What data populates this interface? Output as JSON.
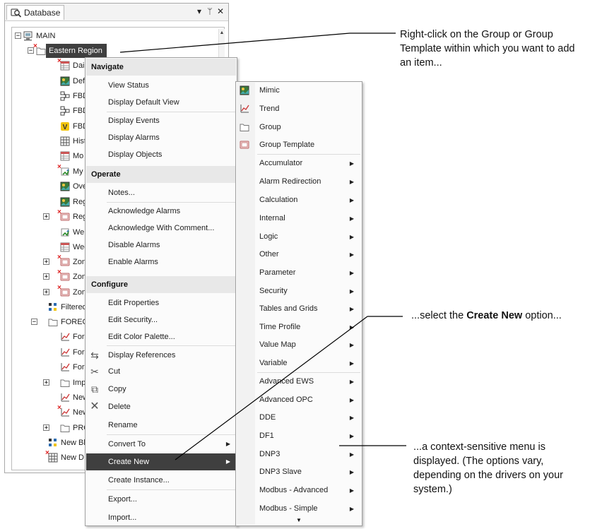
{
  "panel": {
    "title": "Database",
    "controls": {
      "dropdown": "▾",
      "pin": "ᛘ",
      "close": "✕"
    }
  },
  "tree": {
    "items": [
      {
        "label": "MAIN",
        "icon": "server-icon",
        "expander": "−"
      },
      {
        "label": "Eastern Region",
        "icon": "folder-icon",
        "expander": "−"
      },
      {
        "label": "Daily",
        "icon": "table-icon"
      },
      {
        "label": "Defa",
        "icon": "mimic-icon"
      },
      {
        "label": "FBD",
        "icon": "fbd-icon"
      },
      {
        "label": "FBD",
        "icon": "fbd-icon"
      },
      {
        "label": "FBD",
        "icon": "vba-icon"
      },
      {
        "label": "Hist",
        "icon": "grid-icon"
      },
      {
        "label": "Mo",
        "icon": "table-icon"
      },
      {
        "label": "My",
        "icon": "link-icon"
      },
      {
        "label": "Ove",
        "icon": "mimic-icon"
      },
      {
        "label": "Reg",
        "icon": "mimic-icon"
      },
      {
        "label": "Reg",
        "icon": "group-template-icon",
        "expander": "+"
      },
      {
        "label": "Wel",
        "icon": "link-icon"
      },
      {
        "label": "Wee",
        "icon": "table-icon"
      },
      {
        "label": "Zon",
        "icon": "group-template-icon",
        "expander": "+"
      },
      {
        "label": "Zon",
        "icon": "group-template-icon",
        "expander": "+"
      },
      {
        "label": "Zon",
        "icon": "group-template-icon",
        "expander": "+"
      },
      {
        "label": "Filtered",
        "icon": "filter-icon"
      },
      {
        "label": "FOREC",
        "icon": "folder-icon",
        "expander": "−"
      },
      {
        "label": "Fore",
        "icon": "trend-icon"
      },
      {
        "label": "Fore",
        "icon": "trend-icon"
      },
      {
        "label": "Fore",
        "icon": "trend-icon"
      },
      {
        "label": "Imp",
        "icon": "folder-icon",
        "expander": "+"
      },
      {
        "label": "New",
        "icon": "trend-icon"
      },
      {
        "label": "New",
        "icon": "trend-icon"
      },
      {
        "label": "PRO",
        "icon": "folder-icon",
        "expander": "+"
      },
      {
        "label": "New Bl",
        "icon": "filter-icon"
      },
      {
        "label": "New D",
        "icon": "grid-icon"
      }
    ]
  },
  "context_menu": {
    "sections": {
      "navigate": "Navigate",
      "operate": "Operate",
      "configure": "Configure"
    },
    "items": {
      "view_status": "View Status",
      "display_default_view": "Display Default View",
      "display_events": "Display Events",
      "display_alarms": "Display Alarms",
      "display_objects": "Display Objects",
      "notes": "Notes...",
      "acknowledge_alarms": "Acknowledge Alarms",
      "acknowledge_with_comment": "Acknowledge With Comment...",
      "disable_alarms": "Disable Alarms",
      "enable_alarms": "Enable Alarms",
      "edit_properties": "Edit Properties",
      "edit_security": "Edit Security...",
      "edit_color_palette": "Edit Color Palette...",
      "display_references": "Display References",
      "cut": "Cut",
      "copy": "Copy",
      "delete": "Delete",
      "rename": "Rename",
      "convert_to": "Convert To",
      "create_new": "Create New",
      "create_instance": "Create Instance...",
      "export": "Export...",
      "import": "Import..."
    },
    "arrow": "▶"
  },
  "submenu": {
    "items": [
      {
        "label": "Mimic",
        "icon": "mimic-icon"
      },
      {
        "label": "Trend",
        "icon": "trend-icon"
      },
      {
        "label": "Group",
        "icon": "folder-icon"
      },
      {
        "label": "Group Template",
        "icon": "group-template-icon"
      },
      {
        "label": "Accumulator",
        "sub": true
      },
      {
        "label": "Alarm Redirection",
        "sub": true
      },
      {
        "label": "Calculation",
        "sub": true
      },
      {
        "label": "Internal",
        "sub": true
      },
      {
        "label": "Logic",
        "sub": true
      },
      {
        "label": "Other",
        "sub": true
      },
      {
        "label": "Parameter",
        "sub": true
      },
      {
        "label": "Security",
        "sub": true
      },
      {
        "label": "Tables and Grids",
        "sub": true
      },
      {
        "label": "Time Profile",
        "sub": true
      },
      {
        "label": "Value Map",
        "sub": true
      },
      {
        "label": "Variable",
        "sub": true
      },
      {
        "label": "Advanced EWS",
        "sub": true
      },
      {
        "label": "Advanced OPC",
        "sub": true
      },
      {
        "label": "DDE",
        "sub": true
      },
      {
        "label": "DF1",
        "sub": true
      },
      {
        "label": "DNP3",
        "sub": true
      },
      {
        "label": "DNP3 Slave",
        "sub": true
      },
      {
        "label": "Modbus - Advanced",
        "sub": true
      },
      {
        "label": "Modbus - Simple",
        "sub": true
      }
    ],
    "scroll_down": "▼"
  },
  "annotations": {
    "note1": "Right-click on the Group or Group Template within which you want to add an item...",
    "note2_pre": "...select the ",
    "note2_bold": "Create New",
    "note2_post": " option...",
    "note3": "...a context-sensitive menu is displayed. (The options vary, depending on the drivers on your system.)"
  },
  "colors": {
    "highlight": "#3f3f3f",
    "section_bg": "#e8e8e8",
    "callout_line": "#000000"
  }
}
